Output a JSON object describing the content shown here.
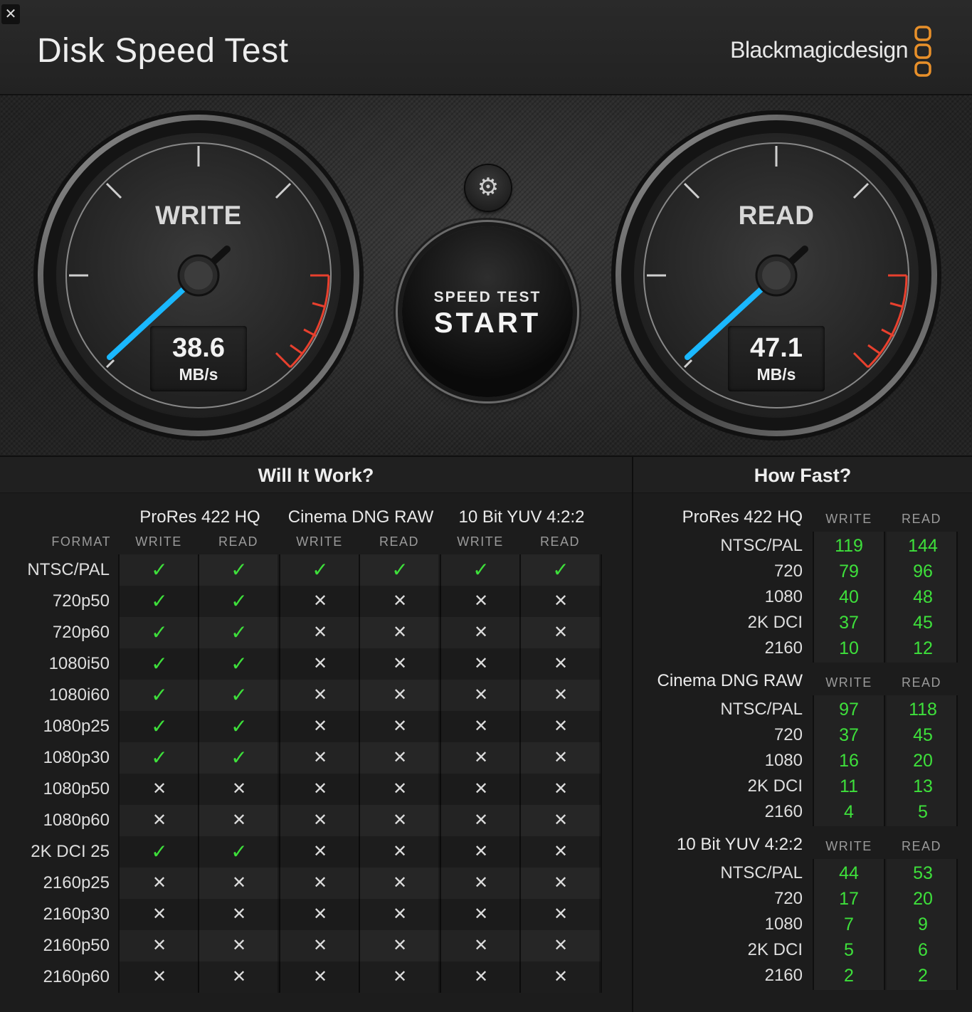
{
  "window": {
    "close_label": "✕",
    "title": "Disk Speed Test",
    "brand": "Blackmagicdesign"
  },
  "gauges": {
    "write": {
      "title": "WRITE",
      "value": "38.6",
      "unit": "MB/s"
    },
    "read": {
      "title": "READ",
      "value": "47.1",
      "unit": "MB/s"
    }
  },
  "controls": {
    "settings_icon": "gear-icon",
    "start_small": "SPEED TEST",
    "start_big": "START"
  },
  "will_it_work": {
    "title": "Will It Work?",
    "format_label": "FORMAT",
    "groups": [
      "ProRes 422 HQ",
      "Cinema DNG RAW",
      "10 Bit YUV 4:2:2"
    ],
    "sub_headers": [
      "WRITE",
      "READ",
      "WRITE",
      "READ",
      "WRITE",
      "READ"
    ],
    "rows": [
      {
        "format": "NTSC/PAL",
        "marks": [
          "yes",
          "yes",
          "yes",
          "yes",
          "yes",
          "yes"
        ]
      },
      {
        "format": "720p50",
        "marks": [
          "yes",
          "yes",
          "no",
          "no",
          "no",
          "no"
        ]
      },
      {
        "format": "720p60",
        "marks": [
          "yes",
          "yes",
          "no",
          "no",
          "no",
          "no"
        ]
      },
      {
        "format": "1080i50",
        "marks": [
          "yes",
          "yes",
          "no",
          "no",
          "no",
          "no"
        ]
      },
      {
        "format": "1080i60",
        "marks": [
          "yes",
          "yes",
          "no",
          "no",
          "no",
          "no"
        ]
      },
      {
        "format": "1080p25",
        "marks": [
          "yes",
          "yes",
          "no",
          "no",
          "no",
          "no"
        ]
      },
      {
        "format": "1080p30",
        "marks": [
          "yes",
          "yes",
          "no",
          "no",
          "no",
          "no"
        ]
      },
      {
        "format": "1080p50",
        "marks": [
          "no",
          "no",
          "no",
          "no",
          "no",
          "no"
        ]
      },
      {
        "format": "1080p60",
        "marks": [
          "no",
          "no",
          "no",
          "no",
          "no",
          "no"
        ]
      },
      {
        "format": "2K DCI 25",
        "marks": [
          "yes",
          "yes",
          "no",
          "no",
          "no",
          "no"
        ]
      },
      {
        "format": "2160p25",
        "marks": [
          "no",
          "no",
          "no",
          "no",
          "no",
          "no"
        ]
      },
      {
        "format": "2160p30",
        "marks": [
          "no",
          "no",
          "no",
          "no",
          "no",
          "no"
        ]
      },
      {
        "format": "2160p50",
        "marks": [
          "no",
          "no",
          "no",
          "no",
          "no",
          "no"
        ]
      },
      {
        "format": "2160p60",
        "marks": [
          "no",
          "no",
          "no",
          "no",
          "no",
          "no"
        ]
      }
    ],
    "yes_symbol": "✓",
    "no_symbol": "✕"
  },
  "how_fast": {
    "title": "How Fast?",
    "write_label": "WRITE",
    "read_label": "READ",
    "sections": [
      {
        "name": "ProRes 422 HQ",
        "rows": [
          {
            "label": "NTSC/PAL",
            "write": "119",
            "read": "144"
          },
          {
            "label": "720",
            "write": "79",
            "read": "96"
          },
          {
            "label": "1080",
            "write": "40",
            "read": "48"
          },
          {
            "label": "2K DCI",
            "write": "37",
            "read": "45"
          },
          {
            "label": "2160",
            "write": "10",
            "read": "12"
          }
        ]
      },
      {
        "name": "Cinema DNG RAW",
        "rows": [
          {
            "label": "NTSC/PAL",
            "write": "97",
            "read": "118"
          },
          {
            "label": "720",
            "write": "37",
            "read": "45"
          },
          {
            "label": "1080",
            "write": "16",
            "read": "20"
          },
          {
            "label": "2K DCI",
            "write": "11",
            "read": "13"
          },
          {
            "label": "2160",
            "write": "4",
            "read": "5"
          }
        ]
      },
      {
        "name": "10 Bit YUV 4:2:2",
        "rows": [
          {
            "label": "NTSC/PAL",
            "write": "44",
            "read": "53"
          },
          {
            "label": "720",
            "write": "17",
            "read": "20"
          },
          {
            "label": "1080",
            "write": "7",
            "read": "9"
          },
          {
            "label": "2K DCI",
            "write": "5",
            "read": "6"
          },
          {
            "label": "2160",
            "write": "2",
            "read": "2"
          }
        ]
      }
    ]
  },
  "colors": {
    "accent_green": "#3ee03b",
    "needle_blue": "#1ab8ff",
    "redline": "#e8402e",
    "logo_orange": "#e8902a"
  }
}
